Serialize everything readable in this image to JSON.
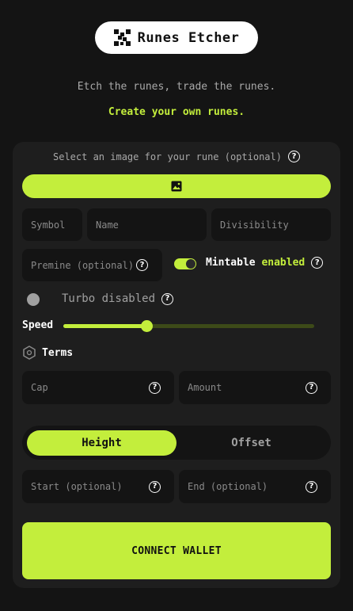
{
  "header": {
    "title": "Runes Etcher",
    "logo_icon": "qr-rune-icon"
  },
  "intro": {
    "tagline": "Etch the runes, trade the runes.",
    "accent_line": "Create your own runes."
  },
  "form": {
    "image_select_label": "Select an image for your rune (optional)",
    "upload_icon": "image-icon",
    "symbol_placeholder": "Symbol",
    "name_placeholder": "Name",
    "divisibility_placeholder": "Divisibility",
    "premine_placeholder": "Premine (optional)",
    "mintable_label": "Mintable",
    "mintable_state": "enabled",
    "turbo_label": "Turbo disabled",
    "speed_label": "Speed",
    "speed_value": 0.33,
    "terms_label": "Terms",
    "cap_placeholder": "Cap",
    "amount_placeholder": "Amount",
    "segment": {
      "height_label": "Height",
      "offset_label": "Offset",
      "selected": "Height"
    },
    "start_placeholder": "Start (optional)",
    "end_placeholder": "End (optional)",
    "connect_label": "CONNECT WALLET"
  },
  "colors": {
    "accent": "#c3ee3c",
    "background": "#141414",
    "card": "#1e1e1e"
  }
}
